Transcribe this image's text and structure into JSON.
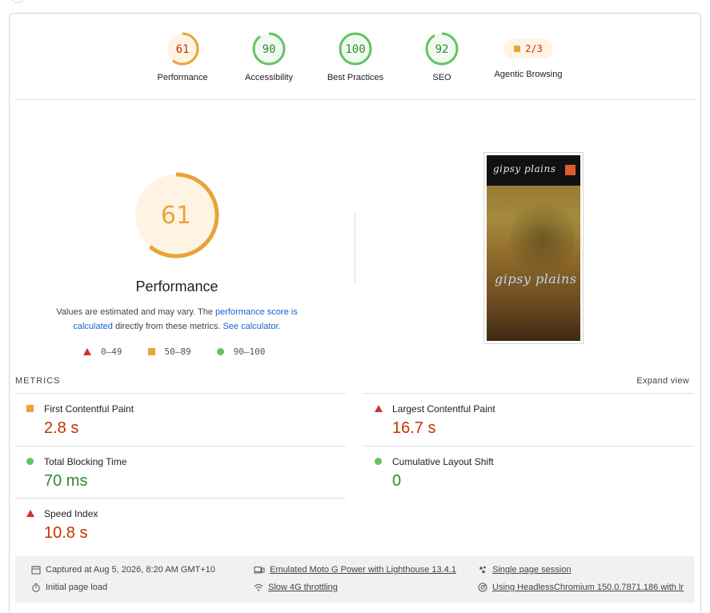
{
  "categories": [
    {
      "score": "61",
      "label": "Performance",
      "color": "#e8a33a",
      "text_color": "#c33300",
      "fill": "#fff4e3",
      "value": 61
    },
    {
      "score": "90",
      "label": "Accessibility",
      "color": "#62c462",
      "text_color": "#2f8a2f",
      "fill": "#f0faf0",
      "value": 90
    },
    {
      "score": "100",
      "label": "Best Practices",
      "color": "#62c462",
      "text_color": "#2f8a2f",
      "fill": "#f0faf0",
      "value": 100
    },
    {
      "score": "92",
      "label": "SEO",
      "color": "#62c462",
      "text_color": "#2f8a2f",
      "fill": "#f0faf0",
      "value": 92
    }
  ],
  "agentic": {
    "score": "2/3",
    "label": "Agentic Browsing"
  },
  "performance": {
    "score": "61",
    "value": 61,
    "title": "Performance",
    "desc_1": "Values are estimated and may vary. The ",
    "link_1": "performance score is calculated",
    "desc_2": " directly from these metrics. ",
    "link_2": "See calculator."
  },
  "legend": {
    "poor": "0–49",
    "average": "50–89",
    "good": "90–100"
  },
  "screenshot": {
    "logo_small": "gipsy plains",
    "logo_large": "gipsy plains"
  },
  "metrics": {
    "heading": "METRICS",
    "expand_label": "Expand view",
    "items": [
      {
        "name": "First Contentful Paint",
        "value": "2.8 s",
        "status": "average"
      },
      {
        "name": "Largest Contentful Paint",
        "value": "16.7 s",
        "status": "poor"
      },
      {
        "name": "Total Blocking Time",
        "value": "70 ms",
        "status": "good"
      },
      {
        "name": "Cumulative Layout Shift",
        "value": "0",
        "status": "good"
      },
      {
        "name": "Speed Index",
        "value": "10.8 s",
        "status": "poor"
      }
    ]
  },
  "footer": {
    "captured": "Captured at Aug 5, 2026, 8:20 AM GMT+10",
    "initial_load": "Initial page load",
    "device": "Emulated Moto G Power with Lighthouse 13.4.1",
    "throttling": "Slow 4G throttling",
    "session": "Single page session",
    "browser": "Using HeadlessChromium 150.0.7871.186 with lr"
  },
  "colors": {
    "poor": "#d0302f",
    "average": "#e8a33a",
    "good": "#62c462"
  }
}
